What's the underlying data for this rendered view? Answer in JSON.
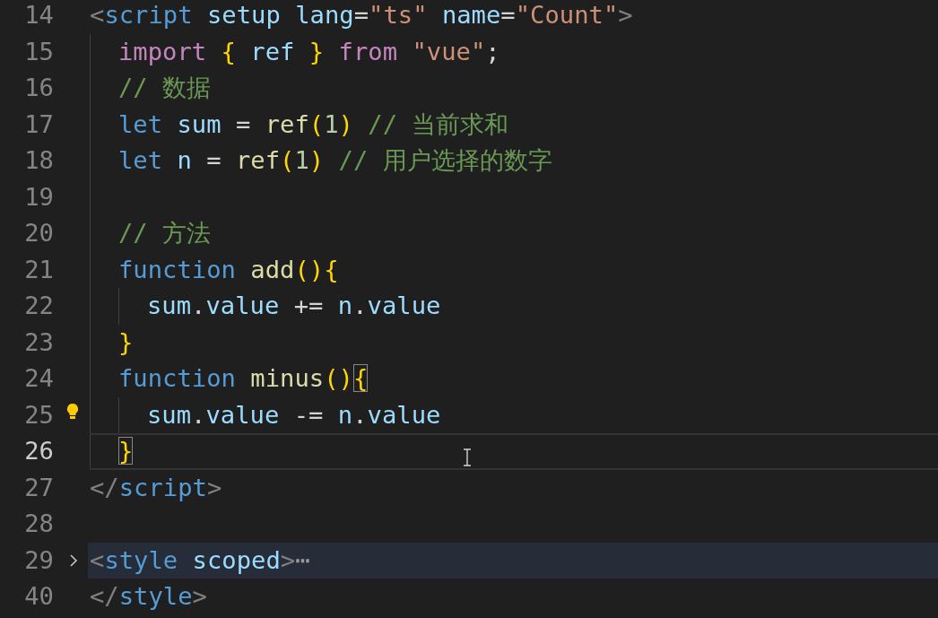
{
  "editor": {
    "lines": [
      {
        "number": "14",
        "tokens": [
          {
            "text": "<",
            "kind": "punct"
          },
          {
            "text": "script ",
            "kind": "tag"
          },
          {
            "text": "setup ",
            "kind": "attr"
          },
          {
            "text": "lang",
            "kind": "attr"
          },
          {
            "text": "=",
            "kind": "plain"
          },
          {
            "text": "\"ts\" ",
            "kind": "string"
          },
          {
            "text": "name",
            "kind": "attr"
          },
          {
            "text": "=",
            "kind": "plain"
          },
          {
            "text": "\"Count\"",
            "kind": "string"
          },
          {
            "text": ">",
            "kind": "punct"
          }
        ],
        "children": [
          {
            "number": "15",
            "tokens": [
              {
                "text": "import ",
                "kind": "keyword"
              },
              {
                "text": "{ ",
                "kind": "bracket"
              },
              {
                "text": "ref ",
                "kind": "var"
              },
              {
                "text": "} ",
                "kind": "bracket"
              },
              {
                "text": "from ",
                "kind": "keyword"
              },
              {
                "text": "\"vue\"",
                "kind": "string"
              },
              {
                "text": ";",
                "kind": "plain"
              }
            ]
          },
          {
            "number": "16",
            "tokens": [
              {
                "text": "// 数据",
                "kind": "comment"
              }
            ]
          },
          {
            "number": "17",
            "tokens": [
              {
                "text": "let ",
                "kind": "storage"
              },
              {
                "text": "sum ",
                "kind": "var"
              },
              {
                "text": "= ",
                "kind": "plain"
              },
              {
                "text": "ref",
                "kind": "func"
              },
              {
                "text": "(",
                "kind": "bracket"
              },
              {
                "text": "1",
                "kind": "number"
              },
              {
                "text": ") ",
                "kind": "bracket"
              },
              {
                "text": "// 当前求和",
                "kind": "comment"
              }
            ]
          },
          {
            "number": "18",
            "tokens": [
              {
                "text": "let ",
                "kind": "storage"
              },
              {
                "text": "n ",
                "kind": "var"
              },
              {
                "text": "= ",
                "kind": "plain"
              },
              {
                "text": "ref",
                "kind": "func"
              },
              {
                "text": "(",
                "kind": "bracket"
              },
              {
                "text": "1",
                "kind": "number"
              },
              {
                "text": ") ",
                "kind": "bracket"
              },
              {
                "text": "// 用户选择的数字",
                "kind": "comment"
              }
            ]
          },
          {
            "number": "19"
          },
          {
            "number": "20",
            "tokens": [
              {
                "text": "// 方法",
                "kind": "comment"
              }
            ]
          },
          {
            "number": "21",
            "tokens": [
              {
                "text": "function ",
                "kind": "storage"
              },
              {
                "text": "add",
                "kind": "func"
              },
              {
                "text": "()",
                "kind": "bracket"
              },
              {
                "text": "{",
                "kind": "bracket"
              }
            ],
            "children": [
              {
                "number": "22",
                "tokens": [
                  {
                    "text": "sum",
                    "kind": "var"
                  },
                  {
                    "text": ".",
                    "kind": "plain"
                  },
                  {
                    "text": "value ",
                    "kind": "var"
                  },
                  {
                    "text": "+= ",
                    "kind": "plain"
                  },
                  {
                    "text": "n",
                    "kind": "var"
                  },
                  {
                    "text": ".",
                    "kind": "plain"
                  },
                  {
                    "text": "value",
                    "kind": "var"
                  }
                ]
              }
            ]
          },
          {
            "number": "23",
            "tokens": [
              {
                "text": "}",
                "kind": "bracket"
              }
            ]
          },
          {
            "number": "24",
            "tokens": [
              {
                "text": "function ",
                "kind": "storage"
              },
              {
                "text": "minus",
                "kind": "func"
              },
              {
                "text": "()",
                "kind": "bracket"
              },
              {
                "text": "{",
                "kind": "match"
              }
            ],
            "children": [
              {
                "number": "25",
                "lightbulb": true,
                "tokens": [
                  {
                    "text": "sum",
                    "kind": "var"
                  },
                  {
                    "text": ".",
                    "kind": "plain"
                  },
                  {
                    "text": "value ",
                    "kind": "var"
                  },
                  {
                    "text": "-= ",
                    "kind": "plain"
                  },
                  {
                    "text": "n",
                    "kind": "var"
                  },
                  {
                    "text": ".",
                    "kind": "plain"
                  },
                  {
                    "text": "value",
                    "kind": "var"
                  }
                ]
              }
            ]
          },
          {
            "number": "26",
            "current": true,
            "tokens": [
              {
                "text": "}",
                "kind": "match"
              }
            ]
          }
        ]
      },
      {
        "number": "27",
        "tokens": [
          {
            "text": "</",
            "kind": "punct"
          },
          {
            "text": "script",
            "kind": "tag"
          },
          {
            "text": ">",
            "kind": "punct"
          }
        ]
      },
      {
        "number": "28"
      },
      {
        "number": "29",
        "folded": true,
        "tokens": [
          {
            "text": "<",
            "kind": "punct"
          },
          {
            "text": "style ",
            "kind": "tag"
          },
          {
            "text": "scoped",
            "kind": "attr"
          },
          {
            "text": ">",
            "kind": "punct"
          },
          {
            "text": "⋯",
            "kind": "ellipsis"
          }
        ]
      },
      {
        "number": "40",
        "tokens": [
          {
            "text": "</",
            "kind": "punct"
          },
          {
            "text": "style",
            "kind": "tag"
          },
          {
            "text": ">",
            "kind": "punct"
          }
        ]
      }
    ]
  }
}
